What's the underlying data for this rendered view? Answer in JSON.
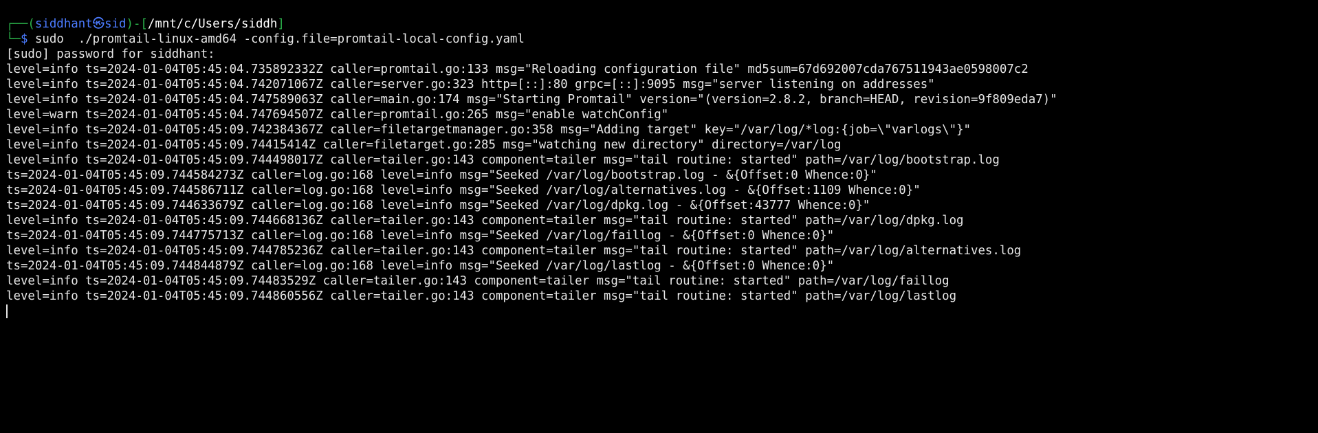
{
  "prompt": {
    "corner_top": "┌──(",
    "user": "siddhant",
    "at_symbol": "㉿",
    "host": "sid",
    "mid": ")-[",
    "path": "/mnt/c/Users/siddh",
    "close": "]",
    "corner_bottom": "└─",
    "dollar": "$",
    "command": " sudo  ./promtail-linux-amd64 -config.file=promtail-local-config.yaml"
  },
  "output_lines": [
    "[sudo] password for siddhant:",
    "level=info ts=2024-01-04T05:45:04.735892332Z caller=promtail.go:133 msg=\"Reloading configuration file\" md5sum=67d692007cda767511943ae0598007c2",
    "level=info ts=2024-01-04T05:45:04.742071067Z caller=server.go:323 http=[::]:80 grpc=[::]:9095 msg=\"server listening on addresses\"",
    "level=info ts=2024-01-04T05:45:04.747589063Z caller=main.go:174 msg=\"Starting Promtail\" version=\"(version=2.8.2, branch=HEAD, revision=9f809eda7)\"",
    "level=warn ts=2024-01-04T05:45:04.747694507Z caller=promtail.go:265 msg=\"enable watchConfig\"",
    "level=info ts=2024-01-04T05:45:09.742384367Z caller=filetargetmanager.go:358 msg=\"Adding target\" key=\"/var/log/*log:{job=\\\"varlogs\\\"}\"",
    "level=info ts=2024-01-04T05:45:09.74415414Z caller=filetarget.go:285 msg=\"watching new directory\" directory=/var/log",
    "level=info ts=2024-01-04T05:45:09.744498017Z caller=tailer.go:143 component=tailer msg=\"tail routine: started\" path=/var/log/bootstrap.log",
    "ts=2024-01-04T05:45:09.744584273Z caller=log.go:168 level=info msg=\"Seeked /var/log/bootstrap.log - &{Offset:0 Whence:0}\"",
    "ts=2024-01-04T05:45:09.744586711Z caller=log.go:168 level=info msg=\"Seeked /var/log/alternatives.log - &{Offset:1109 Whence:0}\"",
    "ts=2024-01-04T05:45:09.744633679Z caller=log.go:168 level=info msg=\"Seeked /var/log/dpkg.log - &{Offset:43777 Whence:0}\"",
    "level=info ts=2024-01-04T05:45:09.744668136Z caller=tailer.go:143 component=tailer msg=\"tail routine: started\" path=/var/log/dpkg.log",
    "ts=2024-01-04T05:45:09.744775713Z caller=log.go:168 level=info msg=\"Seeked /var/log/faillog - &{Offset:0 Whence:0}\"",
    "level=info ts=2024-01-04T05:45:09.744785236Z caller=tailer.go:143 component=tailer msg=\"tail routine: started\" path=/var/log/alternatives.log",
    "ts=2024-01-04T05:45:09.744844879Z caller=log.go:168 level=info msg=\"Seeked /var/log/lastlog - &{Offset:0 Whence:0}\"",
    "level=info ts=2024-01-04T05:45:09.74483529Z caller=tailer.go:143 component=tailer msg=\"tail routine: started\" path=/var/log/faillog",
    "level=info ts=2024-01-04T05:45:09.744860556Z caller=tailer.go:143 component=tailer msg=\"tail routine: started\" path=/var/log/lastlog"
  ],
  "colors": {
    "background": "#000000",
    "text": "#e6e6e6",
    "prompt_green": "#2bb34b",
    "prompt_blue": "#4b7bff",
    "path_white": "#ffffff"
  }
}
